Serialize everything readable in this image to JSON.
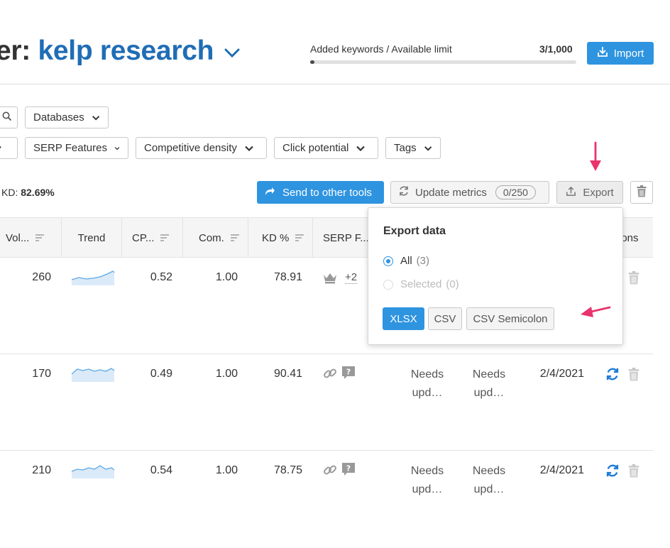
{
  "header": {
    "title_prefix": "er:",
    "project_name": "kelp research",
    "limit_label": "Added keywords / Available limit",
    "limit_value": "3/1,000",
    "limit_progress": 0.003,
    "import_label": "Import"
  },
  "filters": {
    "databases_label": "Databases",
    "serp_features_label": "SERP Features",
    "competitive_density_label": "Competitive density",
    "click_potential_label": "Click potential",
    "tags_label": "Tags"
  },
  "toolbar": {
    "kd_prefix": "KD:",
    "kd_value": "82.69%",
    "send_label": "Send to other tools",
    "update_label": "Update metrics",
    "update_counter": "0/250",
    "export_label": "Export"
  },
  "table": {
    "columns": [
      "Vol...",
      "Trend",
      "CP...",
      "Com.",
      "KD %",
      "SERP F...",
      "ions"
    ],
    "rows": [
      {
        "volume": "260",
        "cpc": "0.52",
        "com": "1.00",
        "kd": "78.91",
        "serp_extra": "+2",
        "needs1": "",
        "needs2": "",
        "date": ""
      },
      {
        "volume": "170",
        "cpc": "0.49",
        "com": "1.00",
        "kd": "90.41",
        "serp_extra": "",
        "needs1": "Needs upd…",
        "needs2": "Needs upd…",
        "date": "2/4/2021"
      },
      {
        "volume": "210",
        "cpc": "0.54",
        "com": "1.00",
        "kd": "78.75",
        "serp_extra": "",
        "needs1": "Needs upd…",
        "needs2": "Needs upd…",
        "date": "2/4/2021"
      }
    ]
  },
  "export_popup": {
    "title": "Export data",
    "option_all_label": "All",
    "option_all_count": "(3)",
    "option_selected_label": "Selected",
    "option_selected_count": "(0)",
    "format_xlsx": "XLSX",
    "format_csv": "CSV",
    "format_csv_semicolon": "CSV Semicolon"
  },
  "colors": {
    "accent": "#2e94e0",
    "project": "#1f6db5",
    "annotation": "#e8336d"
  },
  "icons": [
    "chevron-down-icon",
    "import-icon",
    "search-icon",
    "share-arrow-icon",
    "refresh-icon",
    "export-icon",
    "trash-icon",
    "sort-icon",
    "crown-icon",
    "link-icon",
    "question-icon"
  ]
}
